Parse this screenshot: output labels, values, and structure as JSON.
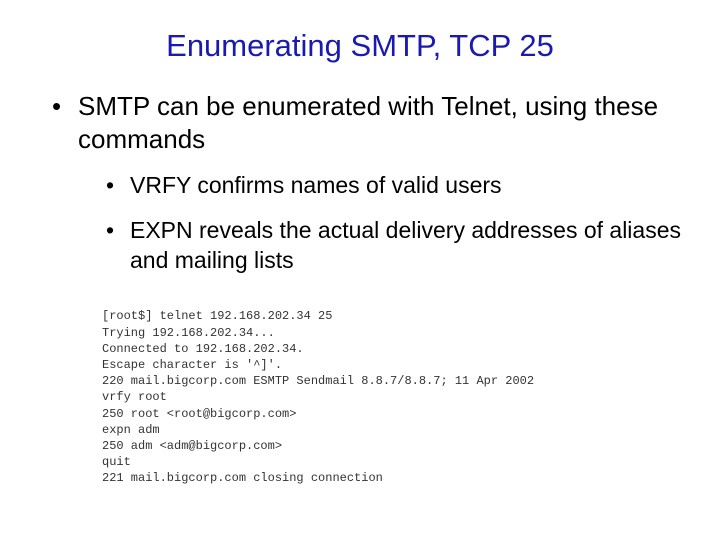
{
  "title": "Enumerating SMTP, TCP 25",
  "bullets": {
    "main": "SMTP can be enumerated with Telnet, using these commands",
    "sub1": "VRFY confirms names of valid users",
    "sub2": "EXPN reveals the actual delivery addresses of aliases and mailing lists"
  },
  "terminal": {
    "l1": "[root$] telnet 192.168.202.34 25",
    "l2": "Trying 192.168.202.34...",
    "l3": "Connected to 192.168.202.34.",
    "l4": "Escape character is '^]'.",
    "l5": "220 mail.bigcorp.com ESMTP Sendmail 8.8.7/8.8.7; 11 Apr 2002",
    "l6": "vrfy root",
    "l7": "250 root <root@bigcorp.com>",
    "l8": "expn adm",
    "l9": "250 adm <adm@bigcorp.com>",
    "l10": "quit",
    "l11": "221 mail.bigcorp.com closing connection"
  }
}
